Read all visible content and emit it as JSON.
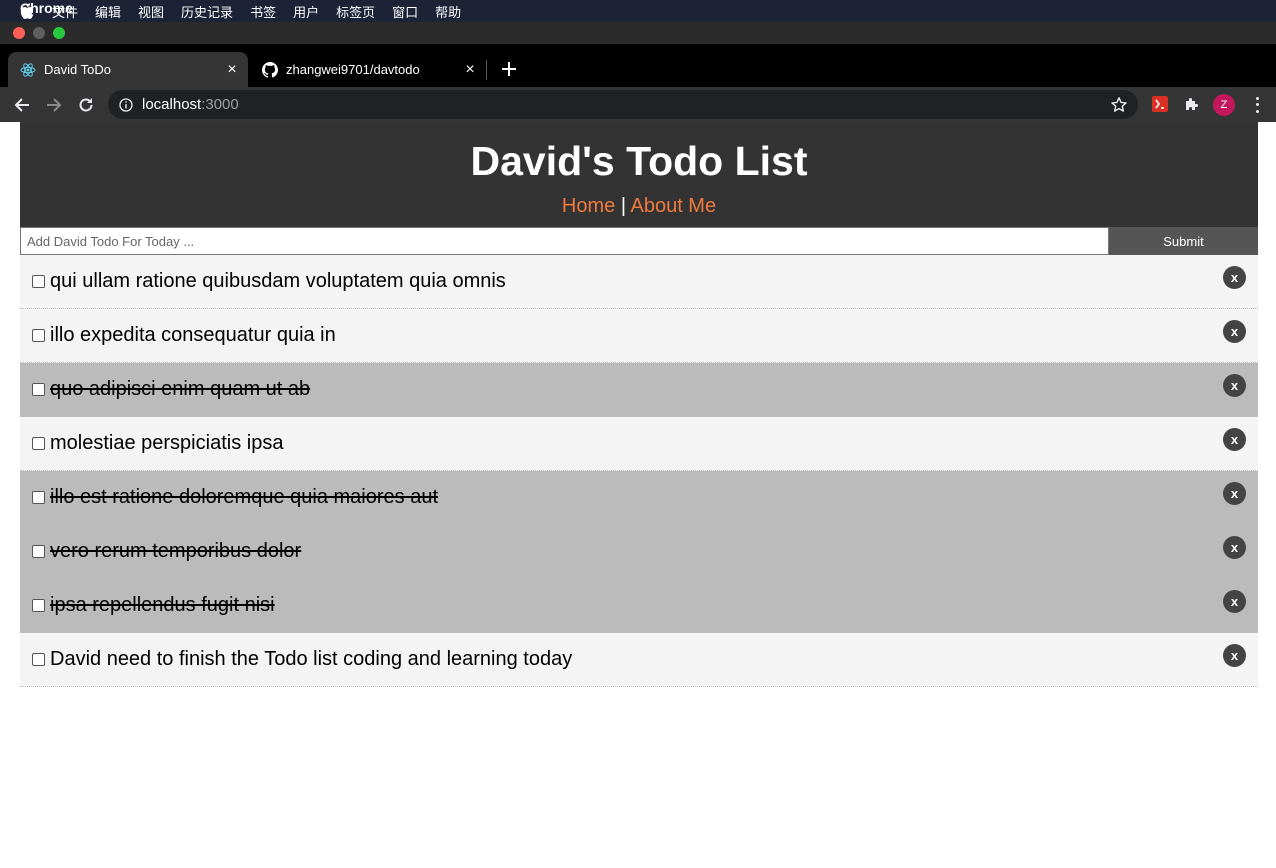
{
  "menubar": {
    "app_name": "Chrome",
    "items": [
      "文件",
      "编辑",
      "视图",
      "历史记录",
      "书签",
      "用户",
      "标签页",
      "窗口",
      "帮助"
    ]
  },
  "tabs": [
    {
      "title": "David ToDo",
      "icon": "react-icon",
      "active": true
    },
    {
      "title": "zhangwei9701/davtodo",
      "icon": "github-icon",
      "active": false
    }
  ],
  "toolbar": {
    "url_host": "localhost",
    "url_port": ":3000",
    "profile_initial": "Z"
  },
  "page": {
    "title": "David's Todo List",
    "nav": {
      "home": "Home",
      "separator": "|",
      "about": "About Me"
    },
    "input_placeholder": "Add David Todo For Today ...",
    "submit_label": "Submit",
    "delete_label": "x",
    "todos": [
      {
        "text": "qui ullam ratione quibusdam voluptatem quia omnis",
        "completed": false
      },
      {
        "text": "illo expedita consequatur quia in",
        "completed": false
      },
      {
        "text": "quo adipisci enim quam ut ab",
        "completed": true
      },
      {
        "text": "molestiae perspiciatis ipsa",
        "completed": false
      },
      {
        "text": "illo est ratione doloremque quia maiores aut",
        "completed": true
      },
      {
        "text": "vero rerum temporibus dolor",
        "completed": true
      },
      {
        "text": "ipsa repellendus fugit nisi",
        "completed": true
      },
      {
        "text": "David need to finish the Todo list coding and learning today",
        "completed": false
      }
    ]
  },
  "colors": {
    "header_bg": "#333333",
    "link": "#f07b3f",
    "completed_bg": "#bbbbbb",
    "active_bg": "#f4f4f4"
  }
}
